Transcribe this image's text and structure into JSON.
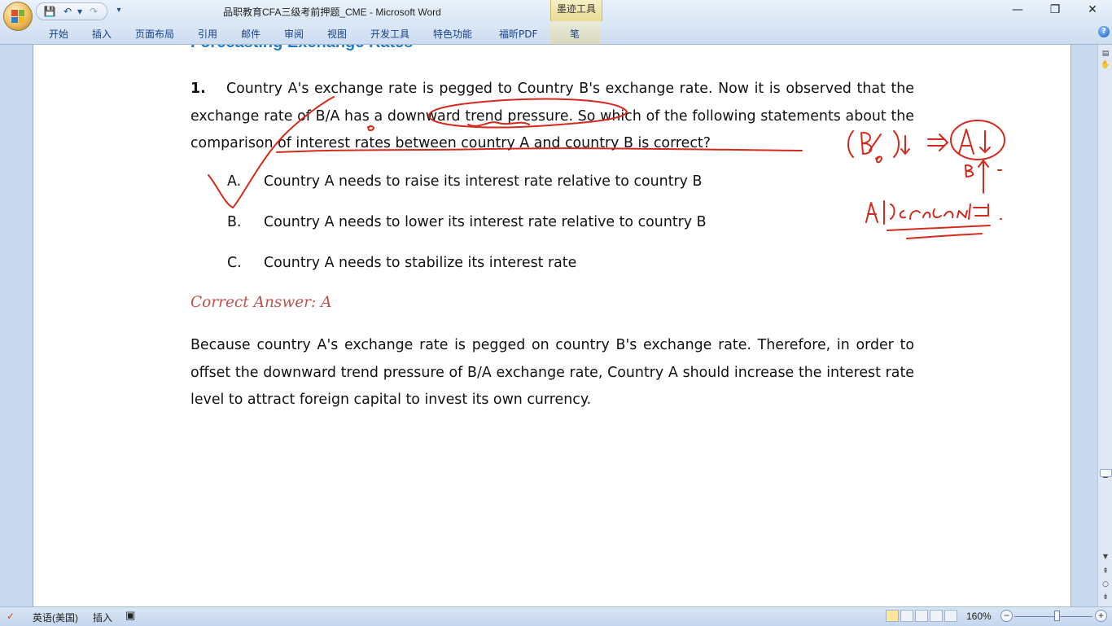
{
  "window": {
    "title": "品职教育CFA三级考前押题_CME - Microsoft Word",
    "contextual_tab_group": "墨迹工具",
    "controls": {
      "minimize": "—",
      "restore": "❐",
      "close": "✕"
    }
  },
  "quick_access": {
    "save_icon": "💾",
    "undo_icon": "↶",
    "redo_icon": "↷",
    "customize_icon": "▾"
  },
  "ribbon": {
    "tabs": [
      "开始",
      "插入",
      "页面布局",
      "引用",
      "邮件",
      "审阅",
      "视图",
      "开发工具",
      "特色功能",
      "福昕PDF",
      "笔"
    ],
    "help": "?"
  },
  "document": {
    "section_heading": "Forecasting Exchange Rates",
    "question": {
      "number": "1.",
      "text": "Country A's exchange rate is pegged to Country B's exchange rate. Now it is observed that the exchange rate of B/A has a downward trend pressure. So which of the following statements about the comparison of interest rates between country A and country B is correct?"
    },
    "options": [
      {
        "letter": "A.",
        "text": "Country A needs to raise its interest rate relative to country B"
      },
      {
        "letter": "B.",
        "text": "Country A needs to lower its interest rate relative to country B"
      },
      {
        "letter": "C.",
        "text": "Country A needs to stabilize its interest rate"
      }
    ],
    "answer_label": "Correct Answer: A",
    "explanation": "Because country A's exchange rate is pegged on country B's exchange rate. Therefore, in order to offset the downward trend pressure of B/A exchange rate, Country A should increase the interest rate level to attract foreign capital to invest its own currency.",
    "ink_color": "#d42a1e"
  },
  "statusbar": {
    "language": "英语(美国)",
    "insert_mode": "插入",
    "zoom": "160%",
    "zoom_out": "−",
    "zoom_in": "+"
  }
}
